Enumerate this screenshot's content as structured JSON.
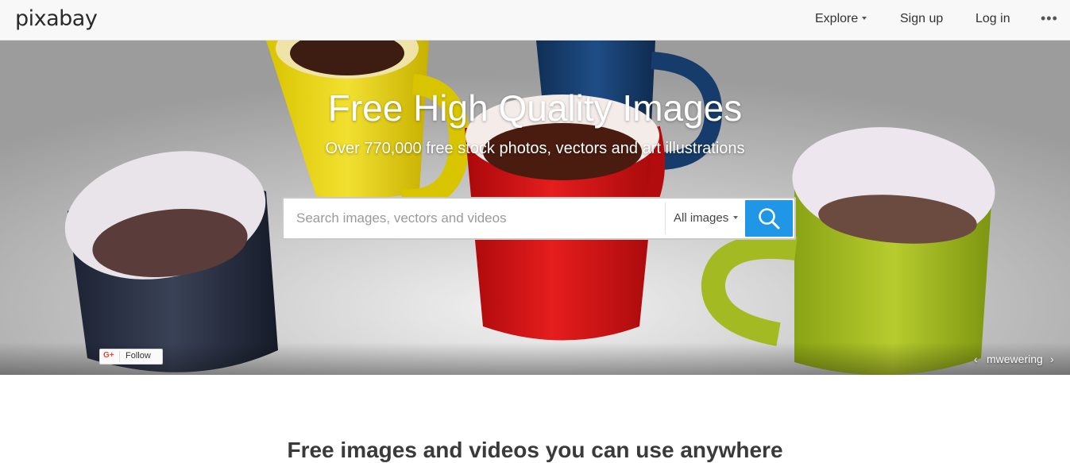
{
  "header": {
    "logo": "pixabay",
    "nav": {
      "explore": "Explore",
      "signup": "Sign up",
      "login": "Log in",
      "more": "•••"
    }
  },
  "hero": {
    "title": "Free High Quality Images",
    "subtitle": "Over 770,000 free stock photos, vectors and art illustrations",
    "search": {
      "placeholder": "Search images, vectors and videos",
      "value": "",
      "type_selected": "All images"
    },
    "follow": {
      "icon": "G+",
      "label": "Follow"
    },
    "credit": {
      "prev": "‹",
      "name": "mwewering",
      "next": "›"
    }
  },
  "main": {
    "headline": "Free images and videos you can use anywhere"
  },
  "colors": {
    "accent": "#1f97e6",
    "header_bg": "#f8f8f8"
  }
}
